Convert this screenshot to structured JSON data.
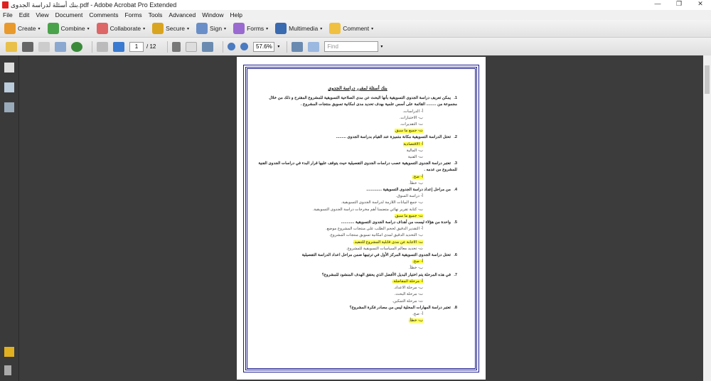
{
  "window": {
    "title": "بنك أسئلة لدراسة الجدوى.pdf - Adobe Acrobat Pro Extended",
    "min": "—",
    "max": "❐",
    "close": "✕"
  },
  "menu": [
    "File",
    "Edit",
    "View",
    "Document",
    "Comments",
    "Forms",
    "Tools",
    "Advanced",
    "Window",
    "Help"
  ],
  "toolbar": [
    {
      "label": "Create",
      "color": "#e89a2c"
    },
    {
      "label": "Combine",
      "color": "#4aa34a"
    },
    {
      "label": "Collaborate",
      "color": "#d66"
    },
    {
      "label": "Secure",
      "color": "#d9a520"
    },
    {
      "label": "Sign",
      "color": "#6a8fc8"
    },
    {
      "label": "Forms",
      "color": "#9a6ad0"
    },
    {
      "label": "Multimedia",
      "color": "#3a6ab0"
    },
    {
      "label": "Comment",
      "color": "#f0c040"
    }
  ],
  "nav": {
    "page": "1",
    "total": "/ 12",
    "zoom": "57.6%",
    "find_placeholder": "Find"
  },
  "document": {
    "title": "بنك أسئلة لمقرر دراسة الجدوى",
    "questions": [
      {
        "n": "1.",
        "text": "يمكن تعريف دراسة الجدوى التسويقية بأنها البحث عن مدى الصلاحية التسويقية للمشروع المقترح و ذلك من خلال مجموعة من ......... القائمة على أسس علمية بهدف تحديد مدى امكانية تسويق منتجات المشروع .",
        "options": [
          {
            "t": "أ- الدراسات.",
            "h": false
          },
          {
            "t": "ب- الاختبارات.",
            "h": false
          },
          {
            "t": "ت- التقديرات.",
            "h": false
          },
          {
            "t": "ث- جميع ما سبق.",
            "h": true
          }
        ]
      },
      {
        "n": "2.",
        "text": "تحتل الدراسة التسويقية مكانة متميزة عند القيام بدراسة الجدوى .........",
        "options": [
          {
            "t": "أ- الاقتصادية",
            "h": true
          },
          {
            "t": "ب- المالية",
            "h": false
          },
          {
            "t": "ت- الفنية",
            "h": false
          }
        ]
      },
      {
        "n": "3.",
        "text": "تعتبر دراسة الجدوى التسويقية عصب دراسات الجدوى التفصيلية حيث يتوقف عليها قرار البدء في دراسات الجدوى الفنية للمشروع من عدمه .",
        "options": [
          {
            "t": "أ- صح.",
            "h": true
          },
          {
            "t": "ب- خطأ.",
            "h": false
          }
        ]
      },
      {
        "n": "4.",
        "text": "من مراحل إعداد دراسة الجدوى التسويقية ..............",
        "options": [
          {
            "t": "أ- دراسة السوق.",
            "h": false
          },
          {
            "t": "ب- جمع البيانات اللازمة لدراسة الجدوى التسويقية.",
            "h": false
          },
          {
            "t": "ت- كتابة تقرير نهائي متضمنا أهم مخرجات دراسة الجدوى التسويقية.",
            "h": false
          },
          {
            "t": "ث- جميع ما سبق.",
            "h": true
          }
        ]
      },
      {
        "n": "5.",
        "text": "واحدة من هؤلاء ليست من أهداف دراسة الجدوى التسويقية ............",
        "options": [
          {
            "t": "أ- التقدير الدقيق لحجم الطلب على منتجات المشروع موضع.",
            "h": false
          },
          {
            "t": "ب- التحديد الدقيق لمدى امكانية تسويق منتجات المشروع.",
            "h": false
          },
          {
            "t": "ت- الاجابة عن مدى قابلية المشروع للتنفيذ.",
            "h": true
          },
          {
            "t": "ث- تحديد معالم السياسات التسويقية للمشروع.",
            "h": false
          }
        ]
      },
      {
        "n": "6.",
        "text": "تحتل دراسة الجدوى التسويقية المركز الأول في ترتيبها ضمن مراحل اعداد الدراسة التفصيلية",
        "options": [
          {
            "t": "أ- صح.",
            "h": true
          },
          {
            "t": "ب- خطأ.",
            "h": false
          }
        ]
      },
      {
        "n": "7.",
        "text": "في هذه المرحلة يتم اختيار البديل الأفضل الذي يحقق الهدف المنشود للمشروع؟",
        "options": [
          {
            "t": "أ- مرحلة المفاضلة.",
            "h": true
          },
          {
            "t": "ب- مرحلة الاعداد.",
            "h": false
          },
          {
            "t": "ت- مرحلة البحث.",
            "h": false
          },
          {
            "t": "ث- مرحلة التمكين.",
            "h": false
          }
        ]
      },
      {
        "n": "8.",
        "text": "تعتبر دراسة المهارات المحلية ليس من مصادر فكرة المشروع؟",
        "options": [
          {
            "t": "أ- صح.",
            "h": false
          },
          {
            "t": "ب- خطأ.",
            "h": true
          }
        ]
      }
    ]
  }
}
